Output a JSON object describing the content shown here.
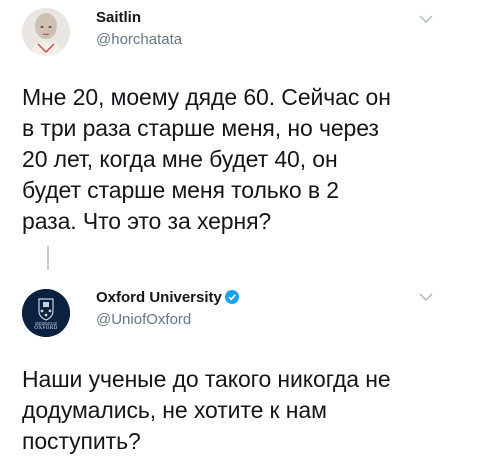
{
  "tweet1": {
    "display_name": "Saitlin",
    "handle": "@horchatata",
    "text": "Мне 20, моему дяде 60. Сейчас он в три раза старше меня, но через 20 лет, когда мне будет 40, он будет старше меня только в 2 раза. Что это за херня?",
    "lines": [
      "Мне 20, моему дяде 60. Сейчас он",
      "в три раза старше меня, но через",
      "20 лет, когда мне будет 40, он",
      "будет старше меня только в 2",
      "раза. Что это за херня?"
    ],
    "avatar_icon": "person-avatar-icon",
    "menu_icon": "chevron-down-icon"
  },
  "tweet2": {
    "display_name": "Oxford University",
    "handle": "@UniofOxford",
    "verified_icon": "verified-badge-icon",
    "avatar_icon": "oxford-crest-icon",
    "avatar_caption": "OXFORD",
    "avatar_tiny_text": "UNIVERSITY OF",
    "lines": [
      "Наши ученые до такого никогда не",
      "додумались, не хотите к нам",
      "поступить?"
    ],
    "menu_icon": "chevron-down-icon"
  },
  "colors": {
    "text": "#14171a",
    "secondary": "#657786",
    "verified": "#1da1f2",
    "oxford_blue": "#0a2240",
    "thread_line": "#c8cdd1"
  }
}
